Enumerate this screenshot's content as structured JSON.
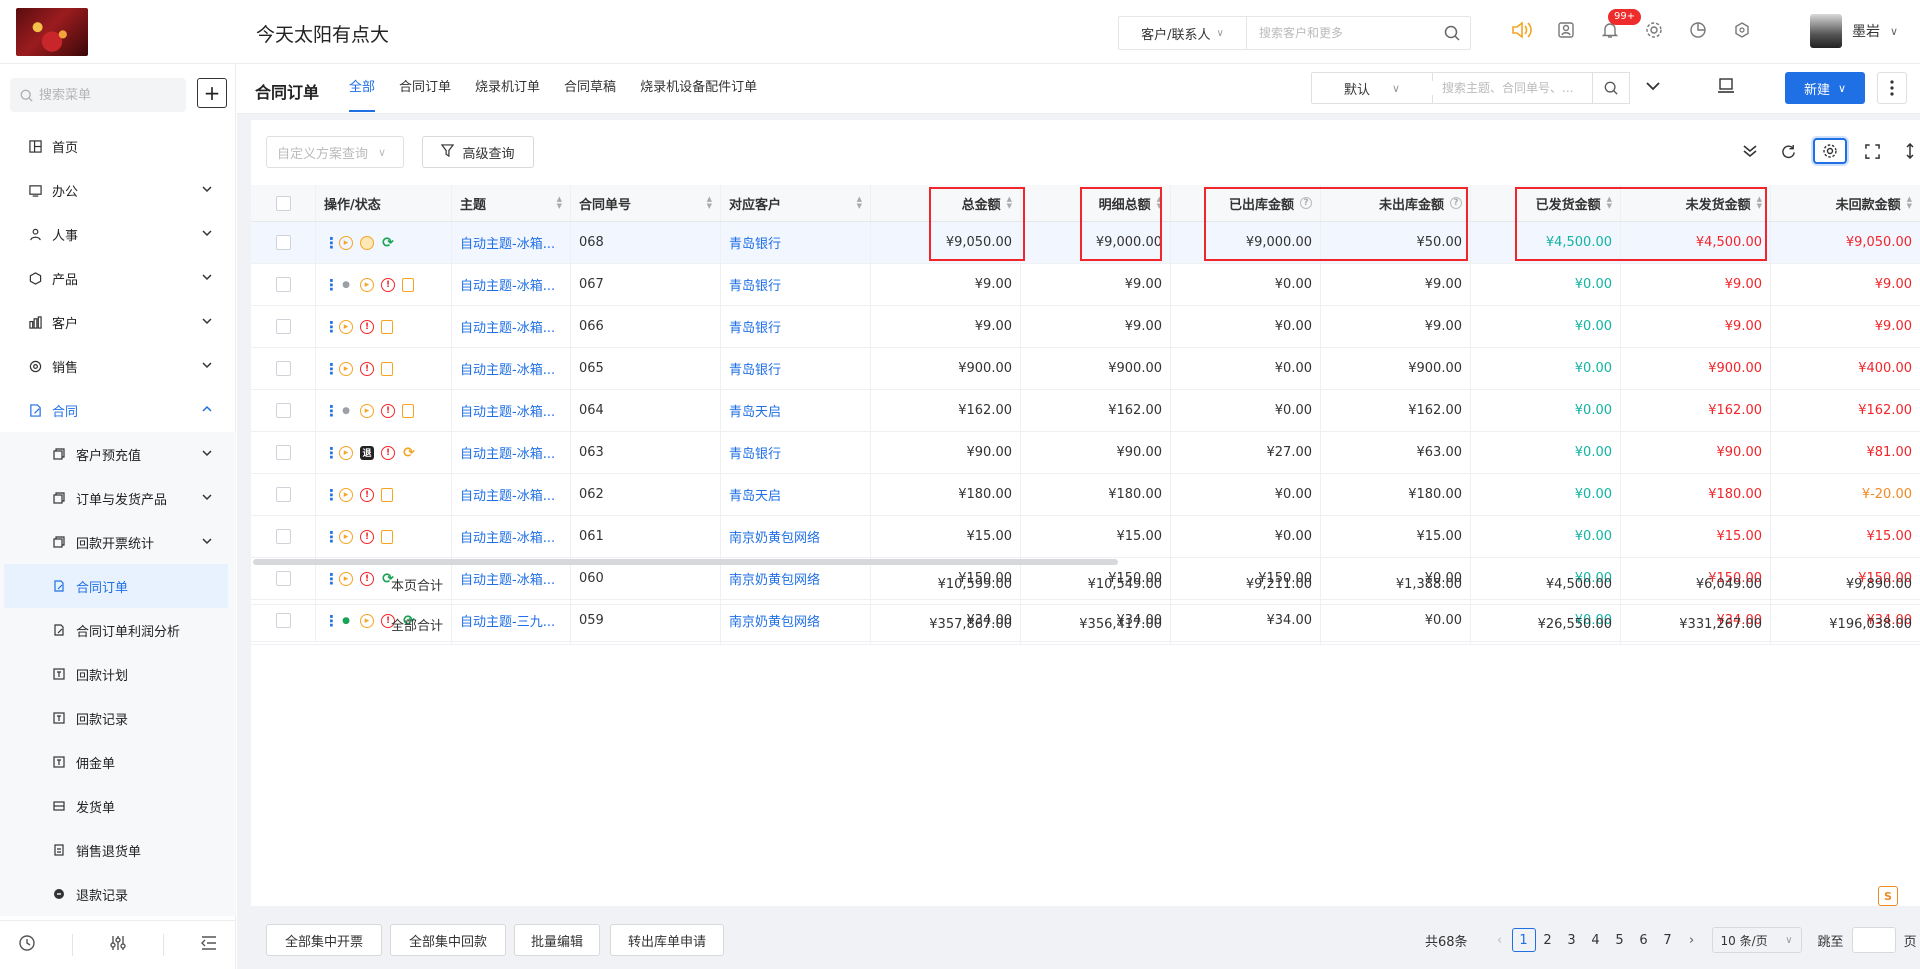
{
  "app": {
    "title": "今天太阳有点大"
  },
  "top_search": {
    "scope": "客户/联系人",
    "placeholder": "搜索客户和更多"
  },
  "notifications": {
    "badge": "99+"
  },
  "user": {
    "name": "墨岩"
  },
  "sidebar": {
    "search_placeholder": "搜索菜单",
    "items": [
      {
        "label": "首页",
        "icon": "dashboard-icon",
        "has_arrow": false
      },
      {
        "label": "办公",
        "icon": "office-icon",
        "has_arrow": true
      },
      {
        "label": "人事",
        "icon": "people-icon",
        "has_arrow": true
      },
      {
        "label": "产品",
        "icon": "product-icon",
        "has_arrow": true
      },
      {
        "label": "客户",
        "icon": "customer-icon",
        "has_arrow": true
      },
      {
        "label": "销售",
        "icon": "sales-icon",
        "has_arrow": true
      },
      {
        "label": "合同",
        "icon": "contract-icon",
        "has_arrow": true,
        "open": true
      }
    ],
    "sub_items": [
      {
        "label": "客户预充值",
        "has_arrow": true
      },
      {
        "label": "订单与发货产品",
        "has_arrow": true
      },
      {
        "label": "回款开票统计",
        "has_arrow": true
      },
      {
        "label": "合同订单",
        "active": true
      },
      {
        "label": "合同订单利润分析"
      },
      {
        "label": "回款计划"
      },
      {
        "label": "回款记录"
      },
      {
        "label": "佣金单"
      },
      {
        "label": "发货单"
      },
      {
        "label": "销售退货单"
      },
      {
        "label": "退款记录"
      }
    ]
  },
  "page": {
    "title": "合同订单",
    "tabs": [
      "全部",
      "合同订单",
      "烧录机订单",
      "合同草稿",
      "烧录机设备配件订单"
    ],
    "active_tab": 0,
    "view_select": "默认",
    "view_search_placeholder": "搜索主题、合同单号、...",
    "new_button": "新建"
  },
  "filters": {
    "scheme_placeholder": "自定义方案查询",
    "advanced_label": "高级查询"
  },
  "table": {
    "headers": [
      "操作/状态",
      "主题",
      "合同单号",
      "对应客户",
      "总金额",
      "明细总额",
      "已出库金额",
      "未出库金额",
      "已发货金额",
      "未发货金额",
      "未回款金额"
    ],
    "rows": [
      {
        "subject": "自动主题-冰箱...",
        "no": "068",
        "customer": "青岛银行",
        "total": "¥9,050.00",
        "detail": "¥9,000.00",
        "out": "¥9,000.00",
        "notout": "¥50.00",
        "shipped": "¥4,500.00",
        "unshipped": "¥4,500.00",
        "unpaid": "¥9,050.00",
        "unpaid_color": "red",
        "ops": [
          "play",
          "coin",
          "cycle"
        ]
      },
      {
        "subject": "自动主题-冰箱...",
        "no": "067",
        "customer": "青岛银行",
        "total": "¥9.00",
        "detail": "¥9.00",
        "out": "¥0.00",
        "notout": "¥9.00",
        "shipped": "¥0.00",
        "unshipped": "¥9.00",
        "unpaid": "¥9.00",
        "unpaid_color": "red",
        "ops": [
          "person",
          "play",
          "warn",
          "doc"
        ]
      },
      {
        "subject": "自动主题-冰箱...",
        "no": "066",
        "customer": "青岛银行",
        "total": "¥9.00",
        "detail": "¥9.00",
        "out": "¥0.00",
        "notout": "¥9.00",
        "shipped": "¥0.00",
        "unshipped": "¥9.00",
        "unpaid": "¥9.00",
        "unpaid_color": "red",
        "ops": [
          "play",
          "warn",
          "doc"
        ]
      },
      {
        "subject": "自动主题-冰箱...",
        "no": "065",
        "customer": "青岛银行",
        "total": "¥900.00",
        "detail": "¥900.00",
        "out": "¥0.00",
        "notout": "¥900.00",
        "shipped": "¥0.00",
        "unshipped": "¥900.00",
        "unpaid": "¥400.00",
        "unpaid_color": "red",
        "ops": [
          "play",
          "warn",
          "doc"
        ]
      },
      {
        "subject": "自动主题-冰箱...",
        "no": "064",
        "customer": "青岛天启",
        "total": "¥162.00",
        "detail": "¥162.00",
        "out": "¥0.00",
        "notout": "¥162.00",
        "shipped": "¥0.00",
        "unshipped": "¥162.00",
        "unpaid": "¥162.00",
        "unpaid_color": "red",
        "ops": [
          "person",
          "play",
          "warn",
          "doc"
        ]
      },
      {
        "subject": "自动主题-冰箱...",
        "no": "063",
        "customer": "青岛银行",
        "total": "¥90.00",
        "detail": "¥90.00",
        "out": "¥27.00",
        "notout": "¥63.00",
        "shipped": "¥0.00",
        "unshipped": "¥90.00",
        "unpaid": "¥81.00",
        "unpaid_color": "red",
        "ops": [
          "play",
          "black",
          "warn",
          "cycle-orange"
        ]
      },
      {
        "subject": "自动主题-冰箱...",
        "no": "062",
        "customer": "青岛天启",
        "total": "¥180.00",
        "detail": "¥180.00",
        "out": "¥0.00",
        "notout": "¥180.00",
        "shipped": "¥0.00",
        "unshipped": "¥180.00",
        "unpaid": "¥-20.00",
        "unpaid_color": "orange",
        "ops": [
          "play",
          "warn",
          "doc"
        ]
      },
      {
        "subject": "自动主题-冰箱...",
        "no": "061",
        "customer": "南京奶黄包网络",
        "total": "¥15.00",
        "detail": "¥15.00",
        "out": "¥0.00",
        "notout": "¥15.00",
        "shipped": "¥0.00",
        "unshipped": "¥15.00",
        "unpaid": "¥15.00",
        "unpaid_color": "red",
        "ops": [
          "play",
          "warn",
          "doc"
        ]
      },
      {
        "subject": "自动主题-冰箱...",
        "no": "060",
        "customer": "南京奶黄包网络",
        "total": "¥150.00",
        "detail": "¥150.00",
        "out": "¥150.00",
        "notout": "¥0.00",
        "shipped": "¥0.00",
        "unshipped": "¥150.00",
        "unpaid": "¥150.00",
        "unpaid_color": "red",
        "ops": [
          "play",
          "warn",
          "cycle"
        ]
      },
      {
        "subject": "自动主题-三九...",
        "no": "059",
        "customer": "南京奶黄包网络",
        "total": "¥34.00",
        "detail": "¥34.00",
        "out": "¥34.00",
        "notout": "¥0.00",
        "shipped": "¥0.00",
        "unshipped": "¥34.00",
        "unpaid": "¥34.00",
        "unpaid_color": "red",
        "ops": [
          "person-green",
          "play",
          "warn",
          "cycle"
        ]
      }
    ],
    "page_sum": {
      "label": "本页合计",
      "total": "¥10,599.00",
      "detail": "¥10,549.00",
      "out": "¥9,211.00",
      "notout": "¥1,388.00",
      "shipped": "¥4,500.00",
      "unshipped": "¥6,049.00",
      "unpaid": "¥9,890.00"
    },
    "all_sum": {
      "label": "全部合计",
      "total": "¥357,867.00",
      "detail": "¥356,417.00",
      "out": "",
      "notout": "",
      "shipped": "¥26,550.00",
      "unshipped": "¥331,267.00",
      "unpaid": "¥196,038.00"
    }
  },
  "footer": {
    "buttons": [
      "全部集中开票",
      "全部集中回款",
      "批量编辑",
      "转出库单申请"
    ],
    "total": "共68条",
    "pages": [
      "1",
      "2",
      "3",
      "4",
      "5",
      "6",
      "7"
    ],
    "current_page": "1",
    "page_size": "10 条/页",
    "jump_label": "跳至",
    "page_suffix": "页"
  },
  "colors": {
    "primary": "#1f6fe5",
    "red": "#f0262b",
    "green": "#12b3a3",
    "orange": "#f08a24"
  }
}
